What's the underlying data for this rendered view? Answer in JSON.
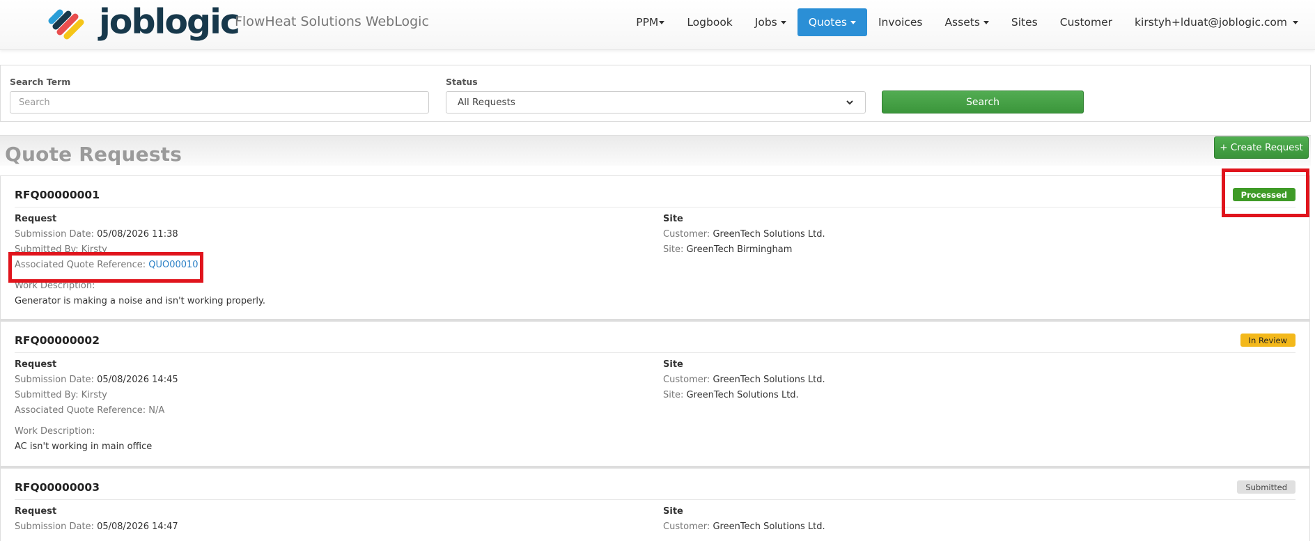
{
  "brand": {
    "wordmark": "joblogic",
    "app_title": "FlowHeat Solutions WebLogic"
  },
  "nav": {
    "items": [
      {
        "label": "PPM",
        "dropdown": true,
        "active": false
      },
      {
        "label": "Logbook",
        "dropdown": false,
        "active": false
      },
      {
        "label": "Jobs",
        "dropdown": true,
        "active": false
      },
      {
        "label": "Quotes",
        "dropdown": true,
        "active": true
      },
      {
        "label": "Invoices",
        "dropdown": false,
        "active": false
      },
      {
        "label": "Assets",
        "dropdown": true,
        "active": false
      },
      {
        "label": "Sites",
        "dropdown": false,
        "active": false
      },
      {
        "label": "Customer",
        "dropdown": false,
        "active": false
      },
      {
        "label": "kirstyh+lduat@joblogic.com",
        "dropdown": true,
        "active": false
      }
    ],
    "active_color": "#2b8fd6"
  },
  "search": {
    "term_label": "Search Term",
    "term_placeholder": "Search",
    "status_label": "Status",
    "status_selected": "All Requests",
    "search_button": "Search"
  },
  "page": {
    "title": "Quote Requests",
    "create_button": "+ Create Request"
  },
  "requests": [
    {
      "id": "RFQ00000001",
      "status": "Processed",
      "request_heading": "Request",
      "submission_label": "Submission Date:",
      "submission_date": "05/08/2026 11:38",
      "submitted_by_label": "Submitted By:",
      "submitted_by": "Kirsty",
      "quote_ref_label": "Associated Quote Reference:",
      "quote_ref": "QUO00010",
      "work_desc_label": "Work Description:",
      "work_desc": "Generator is making a noise and isn't working properly.",
      "site_heading": "Site",
      "customer_label": "Customer:",
      "customer": "GreenTech Solutions Ltd.",
      "site_label": "Site:",
      "site": "GreenTech Birmingham"
    },
    {
      "id": "RFQ00000002",
      "status": "In Review",
      "request_heading": "Request",
      "submission_label": "Submission Date:",
      "submission_date": "05/08/2026 14:45",
      "submitted_by_label": "Submitted By:",
      "submitted_by": "Kirsty",
      "quote_ref_label": "Associated Quote Reference:",
      "quote_ref": "N/A",
      "work_desc_label": "Work Description:",
      "work_desc": "AC isn't working in main office",
      "site_heading": "Site",
      "customer_label": "Customer:",
      "customer": "GreenTech Solutions Ltd.",
      "site_label": "Site:",
      "site": "GreenTech Solutions Ltd."
    },
    {
      "id": "RFQ00000003",
      "status": "Submitted",
      "request_heading": "Request",
      "submission_label": "Submission Date:",
      "submission_date": "05/08/2026 14:47",
      "site_heading": "Site",
      "customer_label": "Customer:",
      "customer": "GreenTech Solutions Ltd."
    }
  ],
  "colors": {
    "processed": "#3f9b27",
    "in_review": "#f3b81b",
    "submitted": "#e0e0e0",
    "primary_green": "#3b963b",
    "annotation_red": "#e0141c",
    "link_blue": "#2a7fc5"
  }
}
